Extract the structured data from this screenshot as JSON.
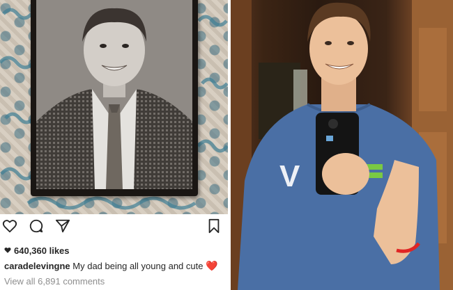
{
  "post": {
    "likes": "640,360 likes",
    "username": "caradelevingne",
    "caption": "My dad being all young and cute",
    "caption_emoji": "❤️",
    "comments_link": "View all 6,891 comments"
  },
  "icons": {
    "like": "heart-icon",
    "comment": "comment-icon",
    "share": "share-icon",
    "save": "bookmark-icon"
  },
  "colors": {
    "heart_red": "#ed1c24",
    "text_dark": "#262626",
    "text_muted": "#8e8e8e",
    "shirt_blue": "#4a6fa5",
    "wristband_red": "#e02424"
  }
}
